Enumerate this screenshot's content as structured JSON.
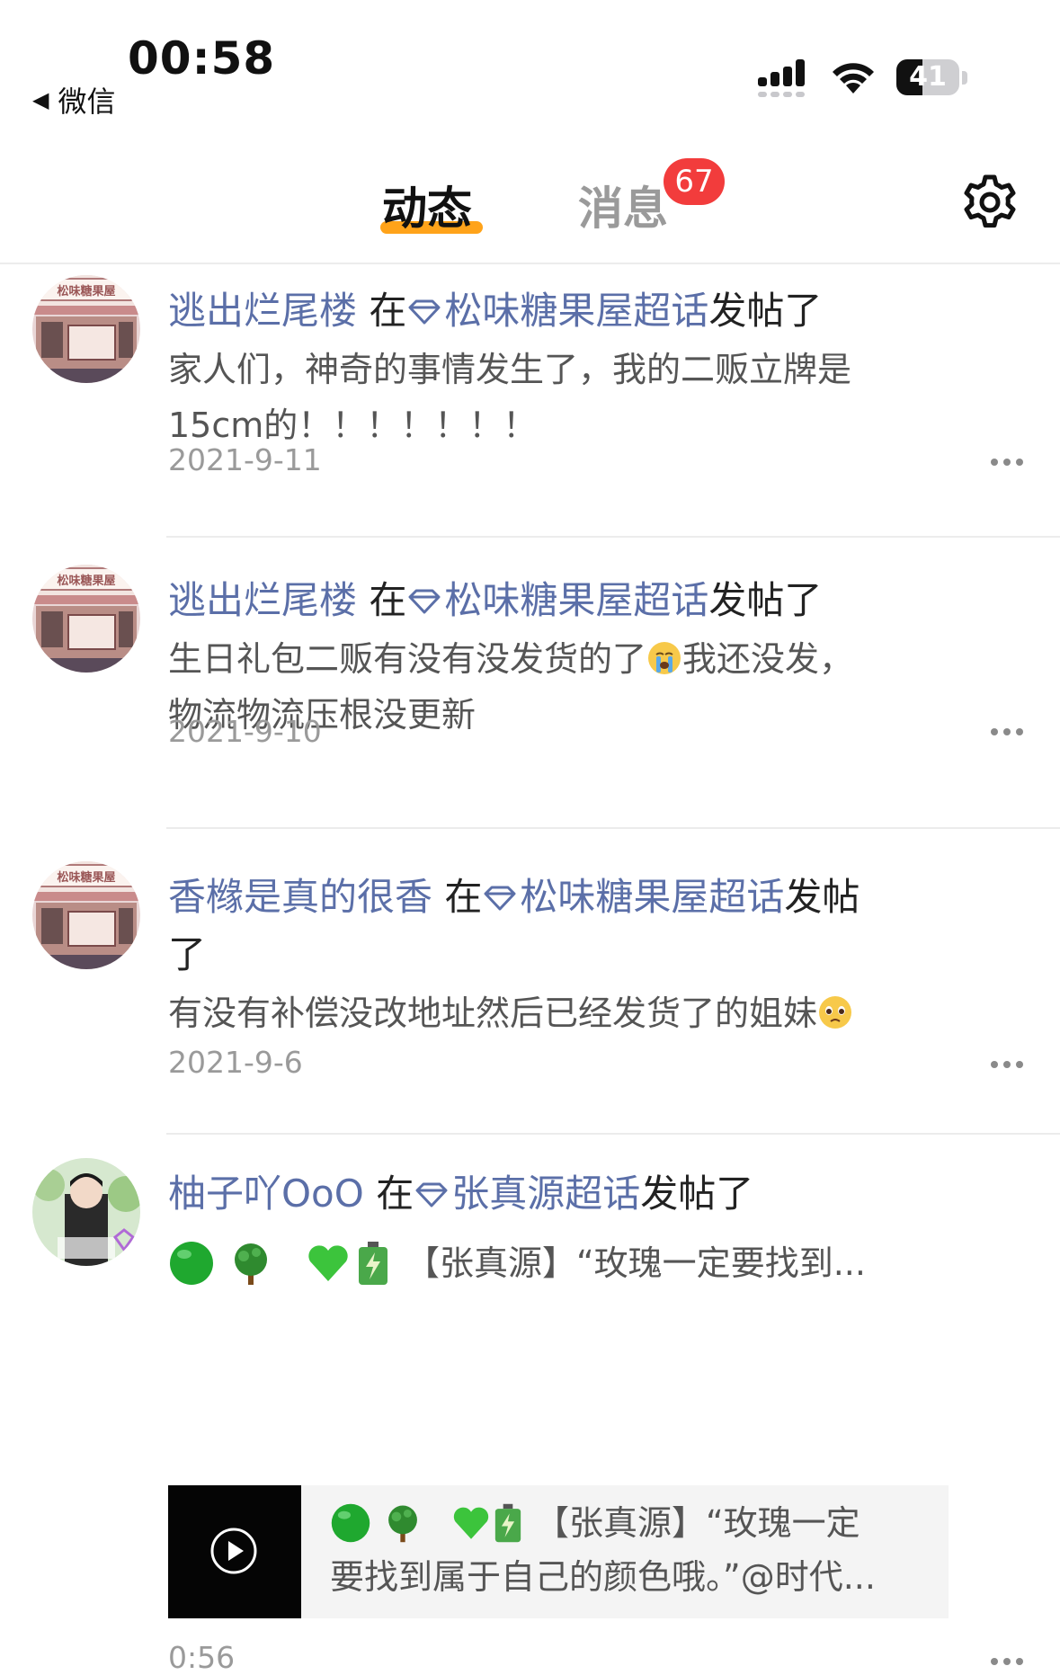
{
  "status_bar": {
    "time": "00:58",
    "back_app": "微信",
    "battery_level": "41"
  },
  "tabs": {
    "dongtai": "动态",
    "xiaoxi": "消息",
    "xiaoxi_badge": "67"
  },
  "posts": [
    {
      "user": "逃出烂尾楼",
      "prefix": "在",
      "topic": "松味糖果屋超话",
      "suffix": "发帖了",
      "body_line1": "家人们，神奇的事情发生了，我的二贩立牌是",
      "body_line2": "15cm的！！！！！！！",
      "date": "2021-9-11"
    },
    {
      "user": "逃出烂尾楼",
      "prefix": "在",
      "topic": "松味糖果屋超话",
      "suffix": "发帖了",
      "body_line1a": "生日礼包二贩有没有没发货的了",
      "body_line1b": "我还没发，",
      "body_line2": "物流物流压根没更新",
      "date": "2021-9-10"
    },
    {
      "user": "香橼是真的很香",
      "prefix": "在",
      "topic": "松味糖果屋超话",
      "suffix": "发帖",
      "suffix_line2": "了",
      "body_line1": "有没有补偿没改地址然后已经发货了的姐妹",
      "date": "2021-9-6"
    },
    {
      "user": "柚子吖OoO",
      "prefix": "在",
      "topic": "张真源超话",
      "suffix": "发帖了",
      "body_line1": "【张真源】“玫瑰一定要找到...",
      "video_line1": "【张真源】“玫瑰一定",
      "video_line2": "要找到属于自己的颜色哦。”@时代...",
      "date": "0:56"
    }
  ],
  "colors": {
    "accent": "#ffa31a",
    "badge": "#f23c3c",
    "link": "#5b6fa8"
  }
}
